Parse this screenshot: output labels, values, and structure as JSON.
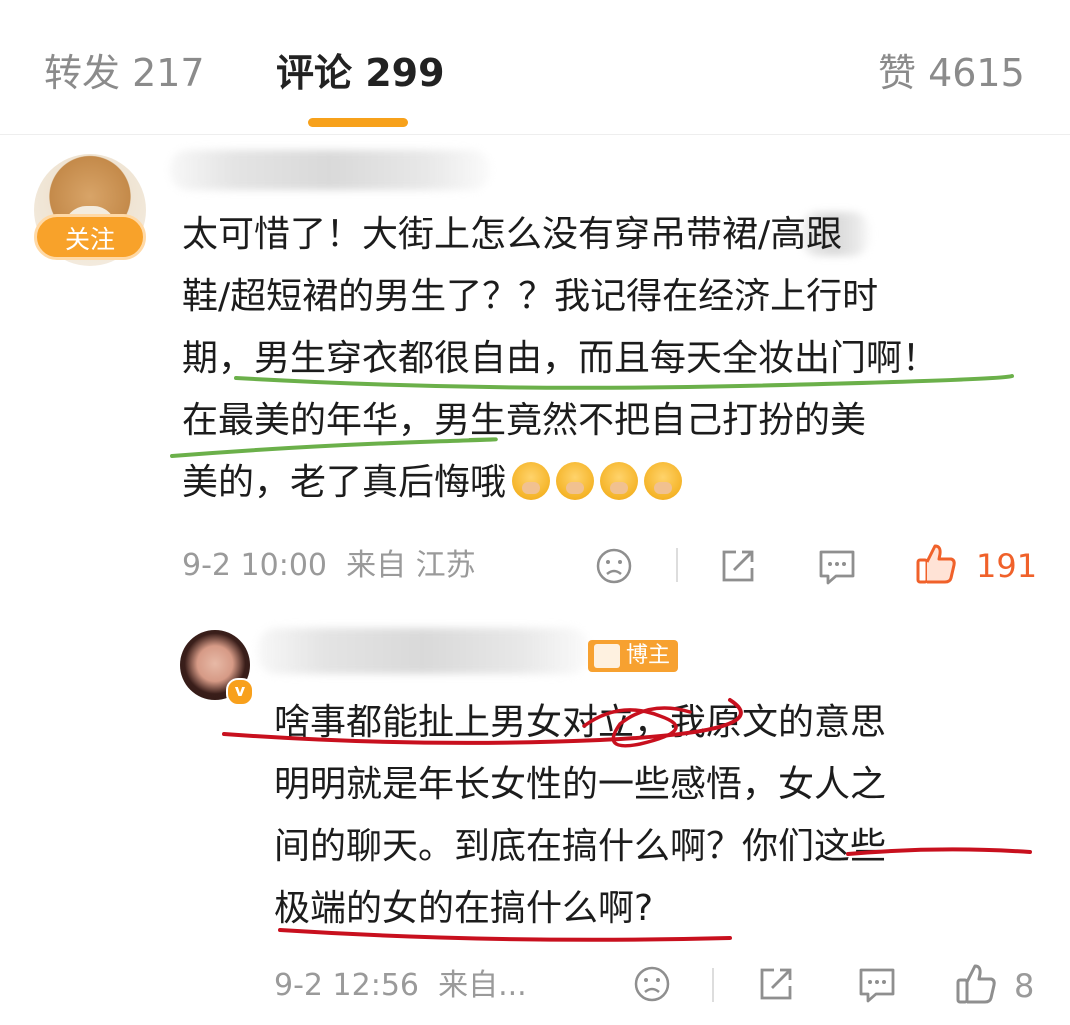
{
  "tabs": {
    "repost": "转发 217",
    "comments": "评论 299",
    "likes": "赞 4615"
  },
  "comment1": {
    "follow_label": "关注",
    "lines": [
      "太可惜了！大街上怎么没有穿吊带裙/高跟",
      "鞋/超短裙的男生了？？我记得在经济上行时",
      "期，男生穿衣都很自由，而且每天全妆出门啊！",
      "在最美的年华，男生竟然不把自己打扮的美",
      "美的，老了真后悔哦"
    ],
    "timestamp": "9-2 10:00",
    "source": "来自 江苏",
    "like_count": "191"
  },
  "reply1": {
    "badge": "博主",
    "verified_mark": "v",
    "lines": [
      "啥事都能扯上男女对立，我原文的意思",
      "明明就是年长女性的一些感悟，女人之",
      "间的聊天。到底在搞什么啊？你们这些",
      "极端的女的在搞什么啊?"
    ],
    "timestamp": "9-2 12:56",
    "source": "来自...",
    "like_count": "8"
  },
  "colors": {
    "accent": "#f7a11b",
    "hot_like": "#f0612a",
    "green_annotation": "#6bb04a",
    "red_annotation": "#c8101e"
  }
}
